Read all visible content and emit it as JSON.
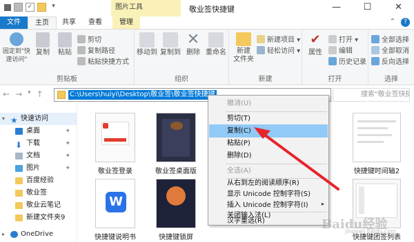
{
  "window": {
    "title": "敬业签快捷键",
    "context_tab_header": "图片工具",
    "minimize": "—",
    "maximize": "☐",
    "close": "✕"
  },
  "tabs": {
    "file": "文件",
    "home": "主页",
    "share": "共享",
    "view": "查看",
    "manage": "管理"
  },
  "ribbon": {
    "clipboard": {
      "label": "剪贴板",
      "pin_quick": "固定到\"快\n速访问\"",
      "copy": "复制",
      "paste": "粘贴",
      "cut": "剪切",
      "copy_path": "复制路径",
      "paste_shortcut": "粘贴快捷方式"
    },
    "organize": {
      "label": "组织",
      "move_to": "移动到",
      "copy_to": "复制到",
      "delete": "删除",
      "rename": "重命名"
    },
    "new": {
      "label": "新建",
      "new_folder": "新建\n文件夹",
      "new_item": "新建项目 ▾",
      "easy_access": "轻松访问 ▾"
    },
    "open": {
      "label": "打开",
      "properties": "属性",
      "open": "打开 ▾",
      "edit": "编辑",
      "history": "历史记录"
    },
    "select": {
      "label": "选择",
      "select_all": "全部选择",
      "select_none": "全部取消",
      "invert": "反向选择"
    }
  },
  "address": {
    "path": "C:\\Users\\huiyi\\Desktop\\敬业签\\敬业签快捷键",
    "search_placeholder": "搜索\"敬业签快捷键\""
  },
  "sidebar": {
    "items": [
      {
        "label": "快速访问"
      },
      {
        "label": "桌面"
      },
      {
        "label": "下载"
      },
      {
        "label": "文档"
      },
      {
        "label": "图片"
      },
      {
        "label": "百度经验"
      },
      {
        "label": "敬业签"
      },
      {
        "label": "敬业云笔记"
      },
      {
        "label": "新建文件夹9"
      },
      {
        "label": "OneDrive"
      }
    ]
  },
  "files": [
    {
      "name": "敬业签登录"
    },
    {
      "name": "敬业签桌面版"
    },
    {
      "name": "快捷键时间轴2"
    },
    {
      "name": "快捷键说明书"
    },
    {
      "name": "快捷键锁屏"
    },
    {
      "name": "快捷键团签列表"
    }
  ],
  "context_menu": {
    "undo": "撤消(U)",
    "cut": "剪切(T)",
    "copy": "复制(C)",
    "paste": "粘贴(P)",
    "delete": "删除(D)",
    "select_all": "全选(A)",
    "rtl": "从右到左的阅读顺序(R)",
    "show_unicode": "显示 Unicode 控制字符(S)",
    "insert_unicode": "插入 Unicode 控制字符(I)",
    "close_ime": "关闭输入法(L)",
    "reconversion": "汉字重选(R)"
  },
  "watermark": {
    "text": "Baidu经验",
    "sub": "jingyan.baidu.com"
  },
  "colors": {
    "accent": "#1979ca",
    "selection": "#0078d7",
    "highlight": "#91c9f7",
    "context_tab": "#faf1b8",
    "arrow": "#e8242a"
  }
}
